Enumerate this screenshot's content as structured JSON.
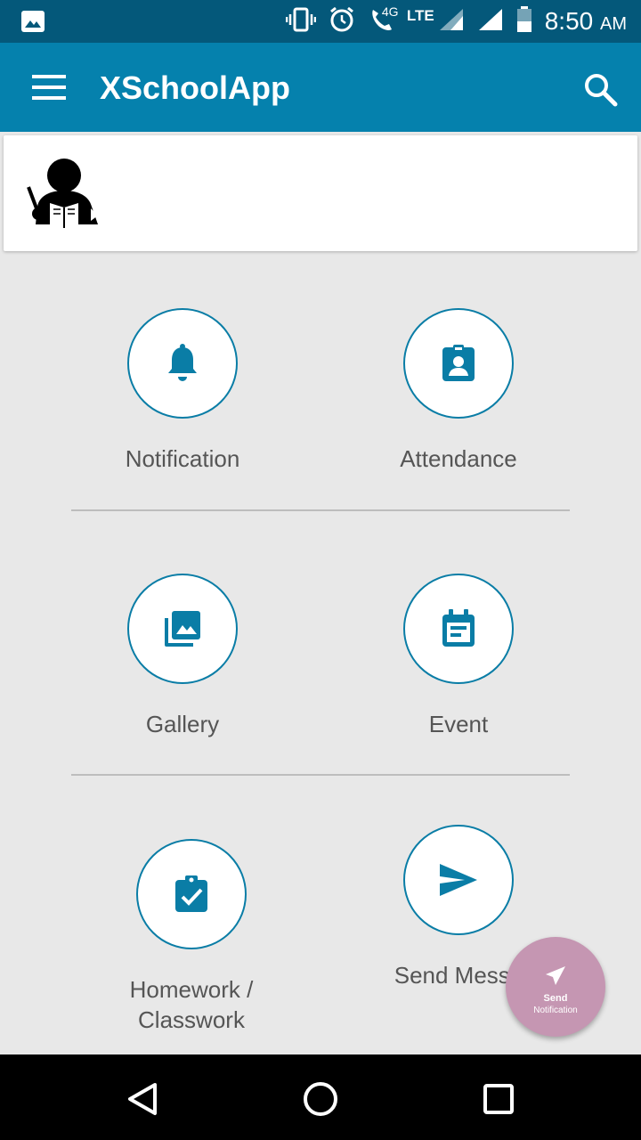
{
  "status_bar": {
    "time": "8:50",
    "ampm": "AM",
    "network": "4G",
    "lte": "LTE"
  },
  "app_bar": {
    "title": "XSchoolApp"
  },
  "menu": {
    "notification": "Notification",
    "attendance": "Attendance",
    "gallery": "Gallery",
    "event": "Event",
    "homework_line1": "Homework /",
    "homework_line2": "Classwork",
    "send_message": "Send Messa"
  },
  "fab": {
    "line1": "Send",
    "line2": "Notification"
  },
  "colors": {
    "primary": "#0581ad",
    "status_bar": "#04587a",
    "fab": "#c596b2",
    "background": "#e8e8e8"
  }
}
